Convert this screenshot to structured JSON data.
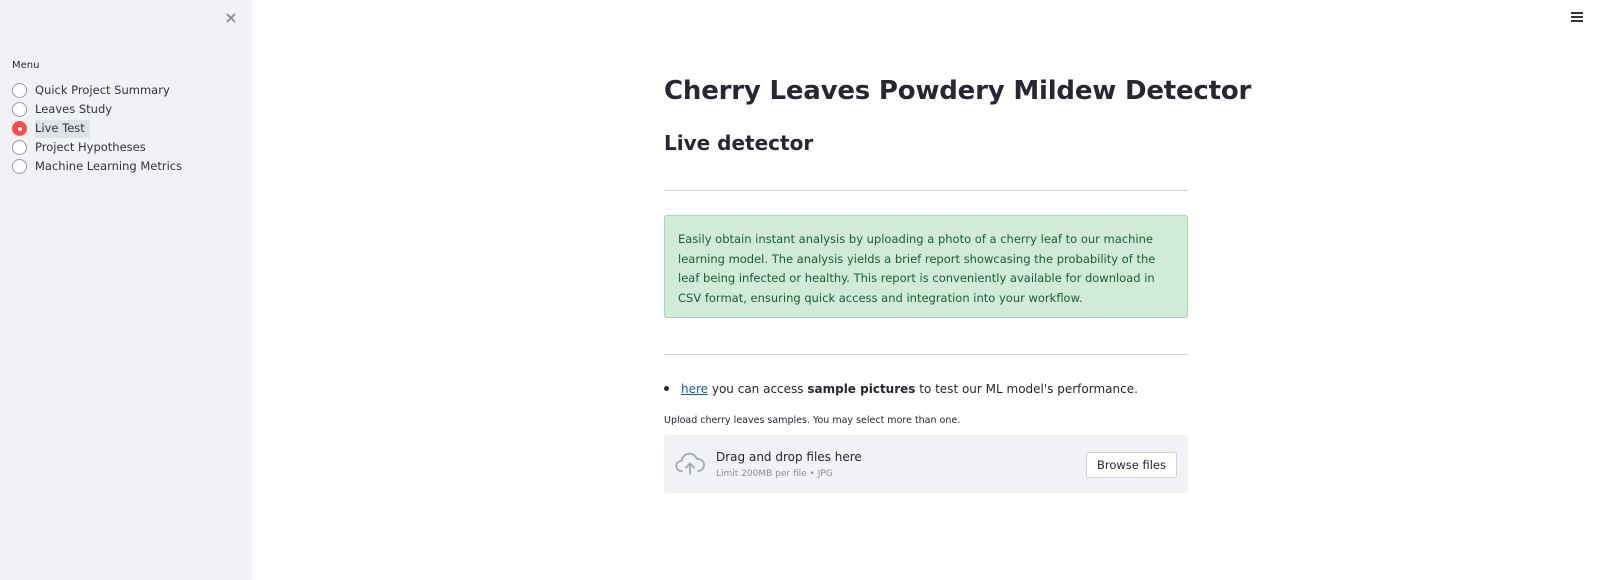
{
  "sidebar": {
    "close_symbol": "×",
    "menu_label": "Menu",
    "items": [
      {
        "label": "Quick Project Summary",
        "selected": false
      },
      {
        "label": "Leaves Study",
        "selected": false
      },
      {
        "label": "Live Test",
        "selected": true
      },
      {
        "label": "Project Hypotheses",
        "selected": false
      },
      {
        "label": "Machine Learning Metrics",
        "selected": false
      }
    ]
  },
  "header": {
    "menu_icon": "hamburger-menu-icon"
  },
  "main": {
    "title": "Cherry Leaves Powdery Mildew Detector",
    "subheader": "Live detector",
    "info_text": "Easily obtain instant analysis by uploading a photo of a cherry leaf to our machine learning model. The analysis yields a brief report showcasing the probability of the leaf being infected or healthy. This report is conveniently available for download in CSV format, ensuring quick access and integration into your workflow.",
    "bullet": {
      "link_text": "here",
      "text_before_bold": " you can access ",
      "bold_text": "sample pictures",
      "text_after_bold": " to test our ML model's performance."
    },
    "uploader": {
      "label": "Upload cherry leaves samples. You may select more than one.",
      "drop_title": "Drag and drop files here",
      "drop_sub": "Limit 200MB per file • JPG",
      "browse_label": "Browse files",
      "icon": "cloud-upload-icon"
    }
  },
  "colors": {
    "accent": "#ff4b4b",
    "sidebar_bg": "#f0f2f6",
    "success_bg": "#d0ecd7",
    "success_text": "#1d5c33",
    "link": "#0e5fa8"
  }
}
